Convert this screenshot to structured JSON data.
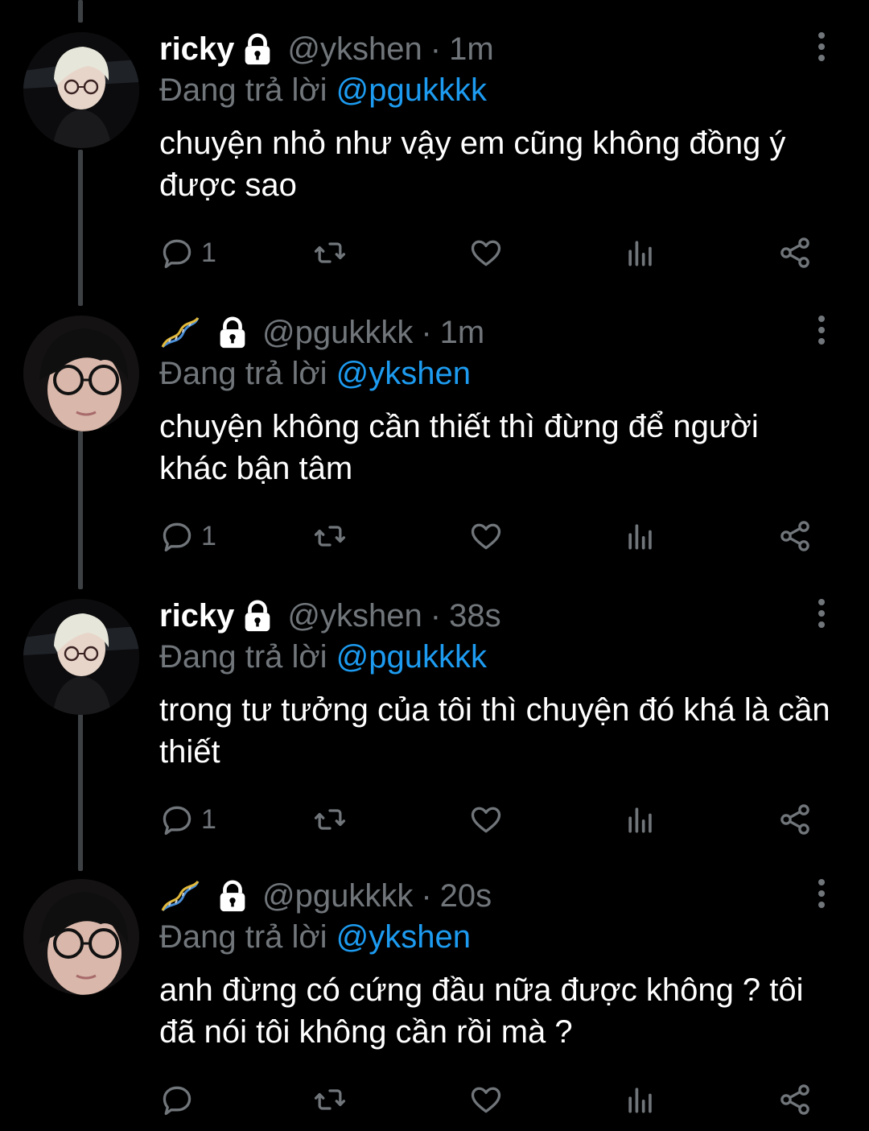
{
  "colors": {
    "background": "#000000",
    "text": "#ffffff",
    "secondary": "#71767b",
    "link": "#1d9bf0",
    "thread_line": "#3e4144"
  },
  "tweets": [
    {
      "display_name": "ricky",
      "name_is_emoji": false,
      "handle": "@ykshen",
      "separator": "·",
      "time": "1m",
      "reply_prefix": "Đang trả lời",
      "reply_to": "@pgukkkk",
      "text": "chuyện nhỏ như vậy em cũng không đồng ý được sao",
      "reply_count": "1",
      "icons": [
        "lock-icon",
        "reply-icon",
        "retweet-icon",
        "like-icon",
        "analytics-icon",
        "share-icon",
        "more-icon"
      ]
    },
    {
      "display_name": "",
      "name_is_emoji": true,
      "handle": "@pgukkkk",
      "separator": "·",
      "time": "1m",
      "reply_prefix": "Đang trả lời",
      "reply_to": "@ykshen",
      "text": "chuyện không cần thiết thì đừng để người khác bận tâm",
      "reply_count": "1",
      "icons": [
        "dna-icon",
        "lock-icon",
        "reply-icon",
        "retweet-icon",
        "like-icon",
        "analytics-icon",
        "share-icon",
        "more-icon"
      ]
    },
    {
      "display_name": "ricky",
      "name_is_emoji": false,
      "handle": "@ykshen",
      "separator": "·",
      "time": "38s",
      "reply_prefix": "Đang trả lời",
      "reply_to": "@pgukkkk",
      "text": "trong tư tưởng của tôi thì chuyện đó khá là cần thiết",
      "reply_count": "1",
      "icons": [
        "lock-icon",
        "reply-icon",
        "retweet-icon",
        "like-icon",
        "analytics-icon",
        "share-icon",
        "more-icon"
      ]
    },
    {
      "display_name": "",
      "name_is_emoji": true,
      "handle": "@pgukkkk",
      "separator": "·",
      "time": "20s",
      "reply_prefix": "Đang trả lời",
      "reply_to": "@ykshen",
      "text": "anh đừng có cứng đầu nữa được không ? tôi đã nói tôi không cần rồi mà ?",
      "reply_count": "",
      "icons": [
        "dna-icon",
        "lock-icon",
        "reply-icon",
        "retweet-icon",
        "like-icon",
        "analytics-icon",
        "share-icon",
        "more-icon"
      ]
    }
  ]
}
